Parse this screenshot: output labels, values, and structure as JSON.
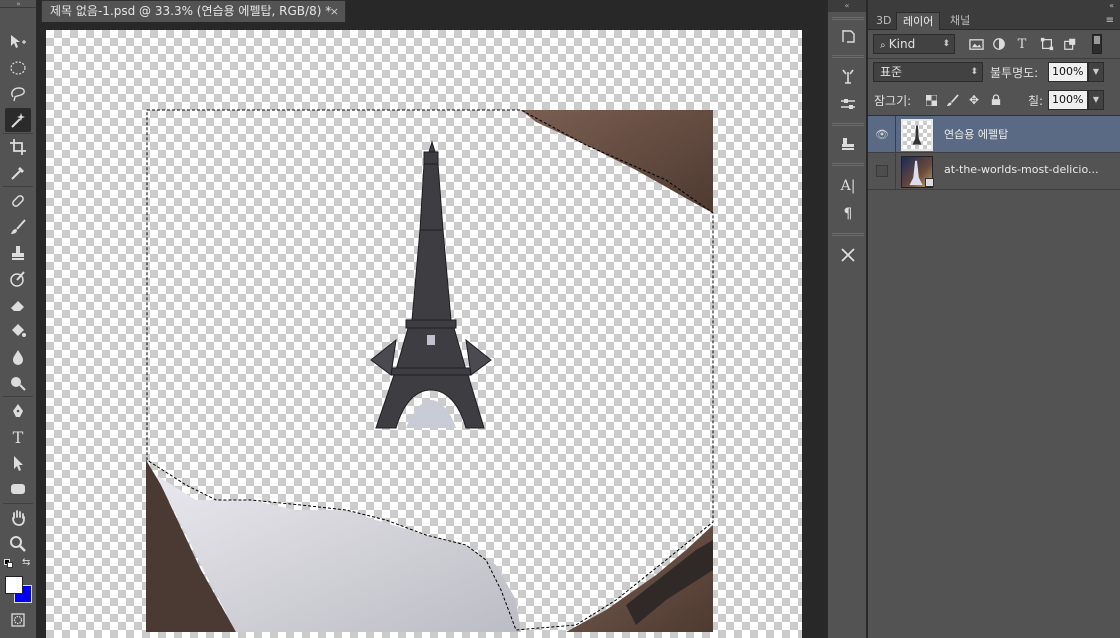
{
  "document": {
    "tab_title": "제목 없음-1.psd @ 33.3% (연습용 에펠탑, RGB/8) *",
    "close_glyph": "×"
  },
  "toolbar": {
    "grip": "»",
    "tools": [
      {
        "name": "move-tool-icon",
        "glyph": "move"
      },
      {
        "name": "marquee-tool-icon",
        "glyph": "marquee"
      },
      {
        "name": "lasso-tool-icon",
        "glyph": "lasso"
      },
      {
        "name": "magic-wand-tool-icon",
        "glyph": "wand",
        "active": true
      },
      {
        "name": "crop-tool-icon",
        "glyph": "crop"
      },
      {
        "name": "eyedropper-tool-icon",
        "glyph": "eyedropper"
      },
      {
        "name": "healing-brush-tool-icon",
        "glyph": "heal"
      },
      {
        "name": "brush-tool-icon",
        "glyph": "brush"
      },
      {
        "name": "clone-stamp-tool-icon",
        "glyph": "stamp"
      },
      {
        "name": "history-brush-tool-icon",
        "glyph": "history"
      },
      {
        "name": "eraser-tool-icon",
        "glyph": "eraser"
      },
      {
        "name": "paint-bucket-tool-icon",
        "glyph": "bucket"
      },
      {
        "name": "blur-tool-icon",
        "glyph": "blur"
      },
      {
        "name": "dodge-tool-icon",
        "glyph": "dodge"
      },
      {
        "name": "pen-tool-icon",
        "glyph": "pen"
      },
      {
        "name": "type-tool-icon",
        "glyph": "T"
      },
      {
        "name": "path-selection-tool-icon",
        "glyph": "arrow"
      },
      {
        "name": "shape-tool-icon",
        "glyph": "rect"
      },
      {
        "name": "hand-tool-icon",
        "glyph": "hand"
      },
      {
        "name": "zoom-tool-icon",
        "glyph": "zoom"
      }
    ],
    "foreground_color": "#ffffff",
    "background_color": "#0000ee"
  },
  "iconbar": {
    "grip": "«",
    "icons": [
      "history-panel-icon",
      "actions-panel-icon",
      "adjustments-panel-icon",
      "properties-panel-icon",
      "character-panel-icon",
      "paragraph-panel-icon",
      "tool-presets-icon"
    ]
  },
  "panel": {
    "collapse_glyph": "«",
    "tabs": [
      {
        "label": "3D",
        "active": false
      },
      {
        "label": "레이어",
        "active": true
      },
      {
        "label": "채널",
        "active": false
      }
    ],
    "menu_glyph": "≡",
    "filter": {
      "kind_label": "Kind",
      "icons": [
        "image-filter-icon",
        "adjustment-filter-icon",
        "type-filter-icon",
        "shape-filter-icon",
        "smart-object-filter-icon"
      ]
    },
    "blend_mode": "표준",
    "opacity_label": "불투명도:",
    "opacity_value": "100%",
    "lock_label": "잠그기:",
    "fill_label": "칠:",
    "fill_value": "100%",
    "layers": [
      {
        "name": "연습용 에펠탑",
        "visible": true,
        "selected": true
      },
      {
        "name": "at-the-worlds-most-delicio...",
        "visible": false,
        "selected": false
      }
    ]
  },
  "colors": {
    "selection_highlight": "#5a6a84",
    "panel_bg": "#535353",
    "app_bg": "#282828"
  }
}
